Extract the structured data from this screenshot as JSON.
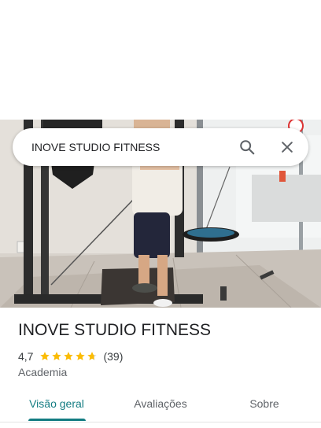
{
  "search": {
    "query": "INOVE STUDIO FITNESS"
  },
  "place": {
    "name": "INOVE STUDIO FITNESS",
    "rating_text": "4,7",
    "rating_value": 4.7,
    "review_count": "(39)",
    "category": "Academia"
  },
  "tabs": [
    {
      "label": "Visão geral",
      "active": true
    },
    {
      "label": "Avaliações",
      "active": false
    },
    {
      "label": "Sobre",
      "active": false
    }
  ],
  "icons": {
    "search": "search-icon",
    "close": "close-icon",
    "star": "star-icon"
  },
  "colors": {
    "accent": "#137c82",
    "star": "#fbbc04",
    "text": "#202124",
    "secondary": "#5f6368"
  }
}
